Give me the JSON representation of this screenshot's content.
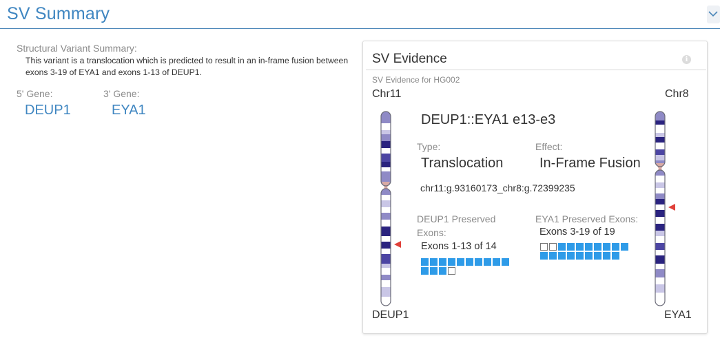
{
  "header": {
    "title": "SV Summary",
    "collapse_icon": "chevron-down-icon"
  },
  "summary": {
    "label": "Structural Variant Summary:",
    "text": "This variant is a translocation which is predicted to result in an in-frame fusion between exons 3-19 of EYA1 and exons 1-13 of DEUP1."
  },
  "genes": {
    "five_prime_label": "5' Gene:",
    "five_prime_value": "DEUP1",
    "three_prime_label": "3' Gene:",
    "three_prime_value": "EYA1"
  },
  "evidence": {
    "title": "SV Evidence",
    "info_icon": "info-icon",
    "subtitle": "SV Evidence for HG002",
    "left_chr": "Chr11",
    "right_chr": "Chr8",
    "left_gene": "DEUP1",
    "right_gene": "EYA1",
    "fusion_name": "DEUP1::EYA1 e13-e3",
    "type_label": "Type:",
    "type_value": "Translocation",
    "effect_label": "Effect:",
    "effect_value": "In-Frame Fusion",
    "coordinates": "chr11:g.93160173_chr8:g.72399235",
    "left_exons_label": "DEUP1 Preserved Exons:",
    "left_exons_value": "Exons 1-13 of 14",
    "left_exons_total": 14,
    "left_exons_preserved": [
      1,
      13
    ],
    "right_exons_label": "EYA1 Preserved Exons:",
    "right_exons_value": "Exons 3-19 of 19",
    "right_exons_total": 19,
    "right_exons_preserved": [
      3,
      19
    ],
    "colors": {
      "exon_filled": "#2e9be8",
      "breakpoint_marker": "#e0413a",
      "accent": "#3f86c1"
    }
  }
}
